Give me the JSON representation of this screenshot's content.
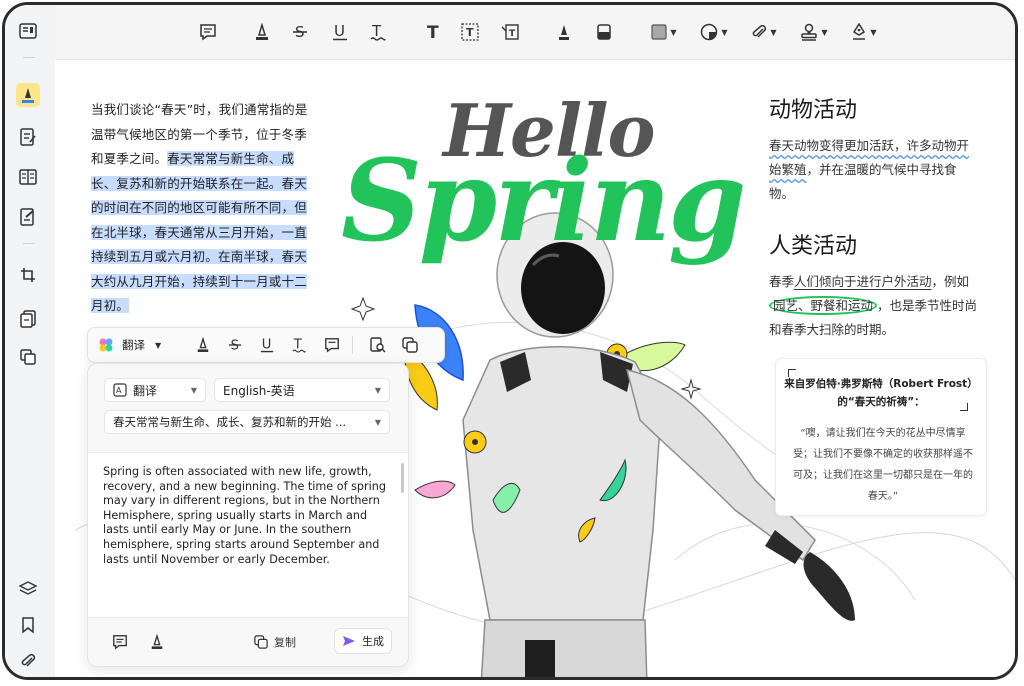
{
  "left_text": {
    "plain": "当我们谈论“春天”时，我们通常指的是温带气候地区的第一个季节，位于冬季和夏季之间。",
    "highlighted": "春天常常与新生命、成长、复苏和新的开始联系在一起。春天的时间在不同的地区可能有所不同，但在北半球，春天通常从三月开始，一直持续到五月或六月初。在南半球，春天大约从九月开始，持续到十一月或十二月初。"
  },
  "hero": {
    "hello": "Hello",
    "spring": "Spring"
  },
  "right": {
    "animal_title": "动物活动",
    "animal_a": "春天动物变得更加活跃，许多动物开始繁殖",
    "animal_b": "，并在温暖的气候中寻找食物。",
    "human_title": "人类活动",
    "human_a": "春季",
    "human_b": "人们倾向于进行户外活动",
    "human_c": "，例如",
    "human_d": "园艺、野餐和运动",
    "human_e": "，也是季节性时尚和春季大扫除的时期。"
  },
  "quote": {
    "title_line1": "来自罗伯特·弗罗斯特（Robert Frost）",
    "title_line2": "的“春天的祈祷”：",
    "body": "“噢，请让我们在今天的花丛中尽情享受；让我们不要像不确定的收获那样遥不可及；让我们在这里一切都只是在一年的春天。”"
  },
  "float_toolbar": {
    "translate_label": "翻译"
  },
  "panel": {
    "mode_value": "翻译",
    "language_value": "English-英语",
    "source_value": "春天常常与新生命、成长、复苏和新的开始 ...",
    "translation": "Spring is often associated with new life, growth, recovery, and a new beginning. The time of spring may vary in different regions, but in the Northern Hemisphere, spring usually starts in March and lasts until early May or June. In the southern hemisphere, spring starts around September and lasts until November or early December.",
    "copy_label": "复制",
    "generate_label": "生成"
  },
  "colors": {
    "accent_green": "#22c35a",
    "highlight": "#c7dcff",
    "active_tool": "#fde68a",
    "generate_icon": "#7c5cf5"
  }
}
